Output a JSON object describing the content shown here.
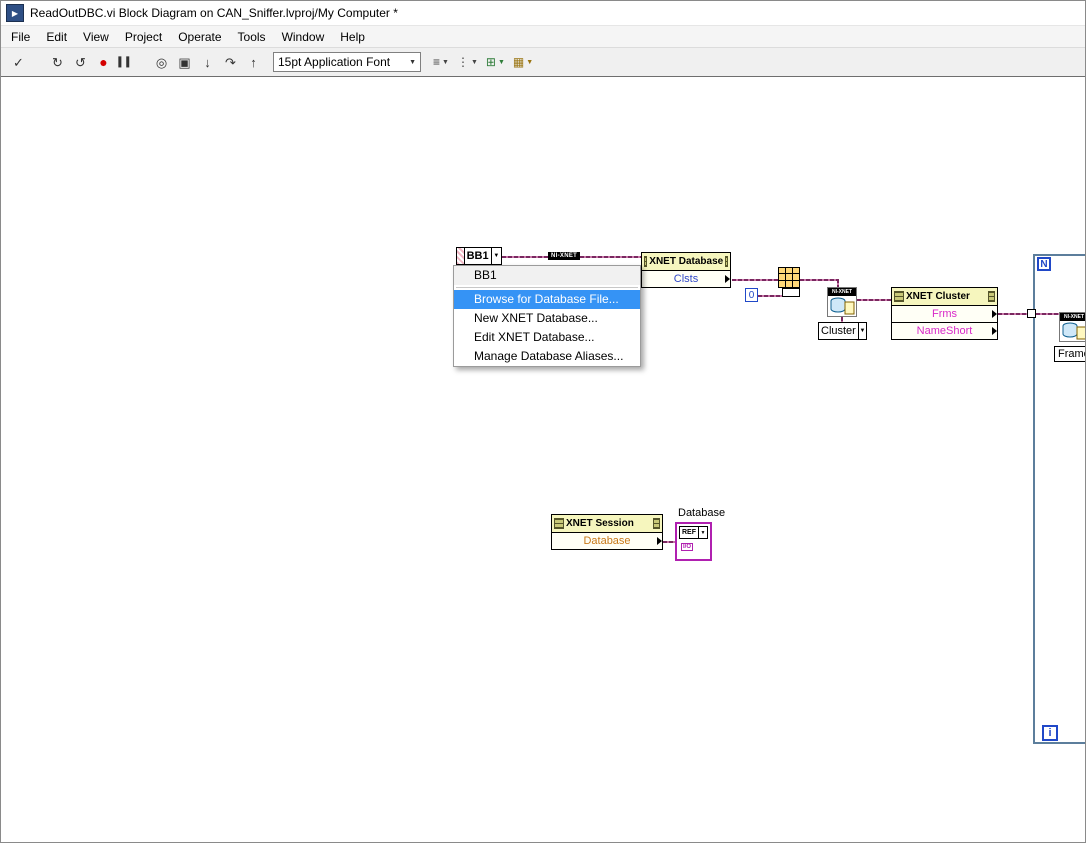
{
  "window": {
    "title": "ReadOutDBC.vi Block Diagram on CAN_Sniffer.lvproj/My Computer *"
  },
  "menubar": {
    "items": [
      "File",
      "Edit",
      "View",
      "Project",
      "Operate",
      "Tools",
      "Window",
      "Help"
    ]
  },
  "toolbar": {
    "font_selector": "15pt Application Font",
    "buttons": [
      {
        "name": "run",
        "glyph": "✓"
      },
      {
        "name": "run-continuous",
        "glyph": "↻"
      },
      {
        "name": "run-continuous-alt",
        "glyph": "↺"
      },
      {
        "name": "abort",
        "glyph": "●"
      },
      {
        "name": "pause",
        "glyph": "▍▍"
      },
      {
        "name": "highlight-execution",
        "glyph": "◎"
      },
      {
        "name": "retain-wire-values",
        "glyph": "▣"
      },
      {
        "name": "step-into",
        "glyph": "↓"
      },
      {
        "name": "step-over",
        "glyph": "↷"
      },
      {
        "name": "step-out",
        "glyph": "↑"
      }
    ],
    "dropdowns": [
      {
        "name": "align-objects",
        "glyph": "≡"
      },
      {
        "name": "distribute-objects",
        "glyph": "⋮"
      },
      {
        "name": "resize-objects",
        "glyph": "⊞"
      },
      {
        "name": "reorder-objects",
        "glyph": "▦"
      }
    ]
  },
  "icons": {
    "caret_down": "▼"
  },
  "diagram": {
    "bb1_ring": {
      "value": "BB1"
    },
    "context_menu": {
      "items": [
        {
          "label": "BB1"
        },
        {
          "label": "Browse for Database File..."
        },
        {
          "label": "New XNET Database..."
        },
        {
          "label": "Edit XNET Database..."
        },
        {
          "label": "Manage Database Aliases..."
        }
      ]
    },
    "wire_badge": "NI-XNET",
    "nixnet_banner": "NI-XNET",
    "nodes": {
      "xnet_database": {
        "title": "XNET Database",
        "rows": [
          {
            "label": "Clsts"
          }
        ]
      },
      "xnet_cluster": {
        "title": "XNET Cluster",
        "rows": [
          {
            "label": "Frms"
          },
          {
            "label": "NameShort"
          }
        ]
      },
      "xnet_session": {
        "title": "XNET Session",
        "rows": [
          {
            "label": "Database"
          }
        ]
      }
    },
    "constants": {
      "zero": "0",
      "cluster_ring": "Cluster"
    },
    "for_loop": {
      "count": "N",
      "iteration": "i"
    },
    "frame_label": "Frame",
    "database_indicator": {
      "label": "Database",
      "ref": "REF",
      "io": "I/O"
    }
  },
  "colors": {
    "menu_highlight": "#3593F5",
    "node_header": "#F6F6BE",
    "wire_purple": "#7A2860",
    "loop_border": "#5C7E9C",
    "terminal_blue": "#2048C8",
    "property_pink": "#D828C8",
    "property_blue": "#3048C8",
    "property_orange": "#C87818",
    "refnum_purple": "#B020B0",
    "abort_red": "#D40000"
  }
}
